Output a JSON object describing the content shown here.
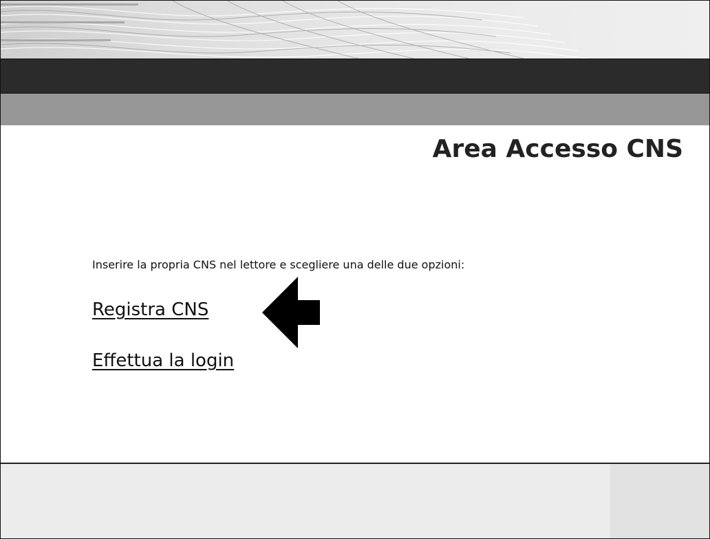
{
  "header": {
    "banner_style": "decorative-wave-pattern"
  },
  "main": {
    "title": "Area Accesso CNS",
    "instructions": "Inserire la propria CNS nel lettore e scegliere una delle due opzioni:",
    "links": [
      {
        "label": "Registra CNS"
      },
      {
        "label": "Effettua la login"
      }
    ],
    "pointer_icon": "left-arrow-icon"
  },
  "colors": {
    "dark_bar": "#2b2b2b",
    "gray_bar": "#979797",
    "footer": "#ececec",
    "text": "#111111"
  }
}
